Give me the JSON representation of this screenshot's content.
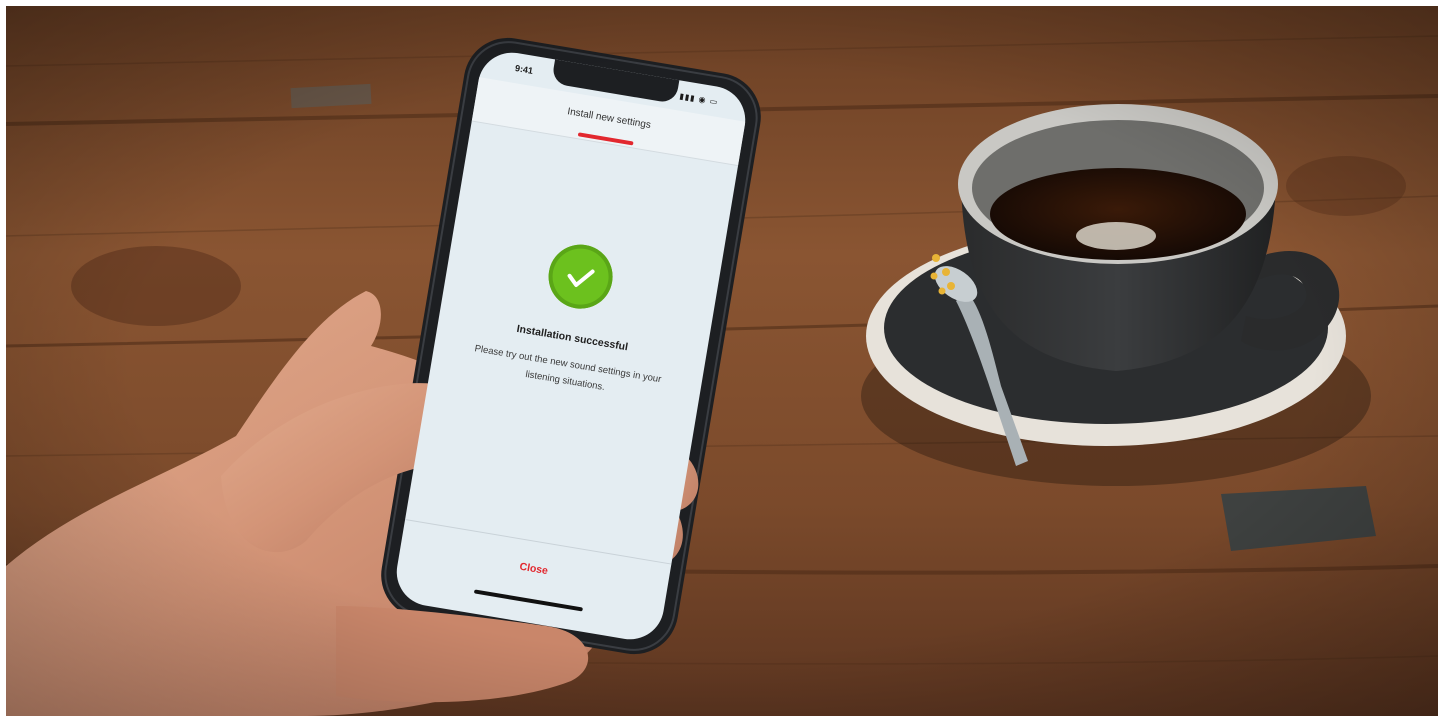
{
  "phone": {
    "status_time": "9:41",
    "status_icons": "▮▮▮ ◉ ▭",
    "nav_title": "Install new settings",
    "success_icon": "checkmark-circle-icon",
    "status_title": "Installation successful",
    "status_message": "Please try out the new sound settings in your listening situations.",
    "close_label": "Close"
  },
  "colors": {
    "accent": "#e2272e",
    "success": "#6cc11e",
    "screen_bg": "#e4edf2",
    "phone_body": "#1d1f22",
    "table_wood": "#7a4a2c"
  }
}
